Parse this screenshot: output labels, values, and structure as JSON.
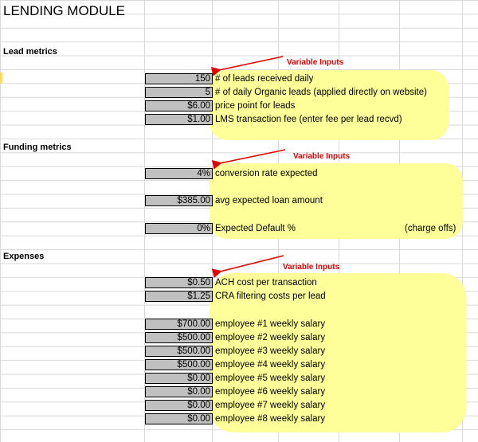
{
  "title": "LENDING MODULE",
  "variable_inputs_label": "Variable Inputs",
  "sections": {
    "lead": {
      "header": "Lead metrics",
      "rows": [
        {
          "value": "150",
          "label": "# of leads received daily"
        },
        {
          "value": "5",
          "label": "# of daily Organic leads (applied directly on website)"
        },
        {
          "value": "$6.00",
          "label": "price point for leads"
        },
        {
          "value": "$1.00",
          "label": "LMS transaction fee (enter fee per lead recvd)"
        }
      ]
    },
    "funding": {
      "header": "Funding metrics",
      "rows": [
        {
          "value": "4%",
          "label": "conversion rate expected"
        },
        {
          "value": "$385.00",
          "label": "avg expected loan amount"
        },
        {
          "value": "0%",
          "label": "Expected Default %",
          "note": "(charge offs)"
        }
      ]
    },
    "expenses": {
      "header": "Expenses",
      "rows": [
        {
          "value": "$0.50",
          "label": "ACH cost per transaction"
        },
        {
          "value": "$1.25",
          "label": "CRA filtering costs per lead"
        },
        {
          "value": "$700.00",
          "label": "employee #1 weekly salary"
        },
        {
          "value": "$500.00",
          "label": "employee #2 weekly salary"
        },
        {
          "value": "$500.00",
          "label": "employee #3 weekly salary"
        },
        {
          "value": "$500.00",
          "label": "employee #4 weekly salary"
        },
        {
          "value": "$0.00",
          "label": "employee #5 weekly salary"
        },
        {
          "value": "$0.00",
          "label": "employee #6 weekly salary"
        },
        {
          "value": "$0.00",
          "label": "employee #7 weekly salary"
        },
        {
          "value": "$0.00",
          "label": "employee #8 weekly salary"
        }
      ]
    }
  },
  "colors": {
    "highlight": "#ffff99",
    "input_fill": "#c0c0c0",
    "annotation": "#e00000",
    "gridline": "#d9d9d9"
  }
}
